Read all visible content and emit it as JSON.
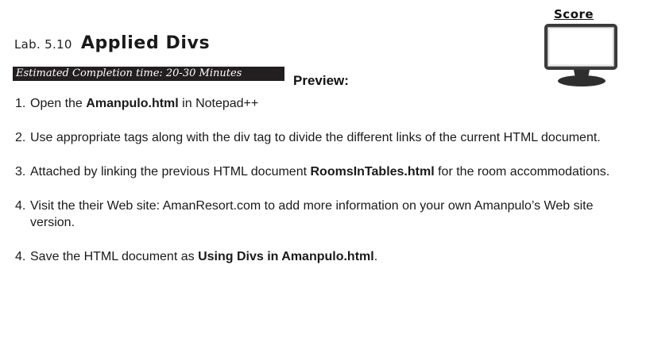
{
  "header": {
    "lab_prefix": "Lab. 5.10",
    "lab_name": "Applied Divs",
    "estimated_time": "Estimated Completion time: 20-30 Minutes",
    "preview_label": "Preview:"
  },
  "score": {
    "label": "Score",
    "icon": "monitor-icon"
  },
  "steps": [
    {
      "num": "1.",
      "before": "Open the ",
      "bold": "Amanpulo.html",
      "after": " in Notepad++"
    },
    {
      "num": "2.",
      "before": "Use appropriate tags along with the div tag to divide the different links of the current HTML document.",
      "bold": "",
      "after": ""
    },
    {
      "num": "3.",
      "before": "Attached by linking the previous HTML document ",
      "bold": "RoomsInTables.html",
      "after": " for the room accommodations."
    },
    {
      "num": "4.",
      "before": "Visit the their Web site: AmanResort.com to add more information on your own Amanpulo’s Web site version.",
      "bold": "",
      "after": ""
    },
    {
      "num": "4.",
      "before": "Save the HTML document as ",
      "bold": "Using Divs in Amanpulo.html",
      "after": "."
    }
  ],
  "colors": {
    "bar_background": "#231f20",
    "monitor_frame": "#2e2e2e",
    "monitor_screen": "#eeeeee"
  }
}
